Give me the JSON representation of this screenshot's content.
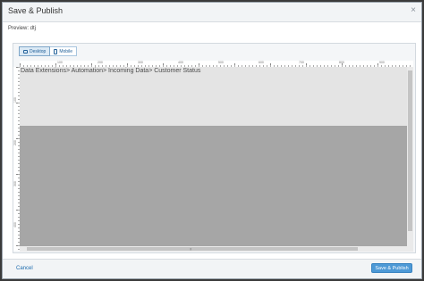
{
  "dialog": {
    "title": "Save & Publish",
    "close_icon": "close-icon",
    "preview_label": "Preview: dtj"
  },
  "view_toggle": {
    "desktop_label": "Desktop",
    "mobile_label": "Mobile",
    "active": "Desktop"
  },
  "ruler": {
    "h_labels": [
      "100",
      "200",
      "300",
      "400",
      "500",
      "600",
      "700",
      "800",
      "900"
    ],
    "v_labels": [
      "100",
      "200",
      "300",
      "400"
    ]
  },
  "preview": {
    "breadcrumb": "Data Extensions> Automation> Incoming Data> Customer Status"
  },
  "footer": {
    "cancel_label": "Cancel",
    "publish_label": "Save & Publish"
  },
  "colors": {
    "accent": "#4d99d6",
    "link": "#1a6aad",
    "canvas_light": "#e4e4e4",
    "canvas_dark": "#a6a6a6"
  }
}
